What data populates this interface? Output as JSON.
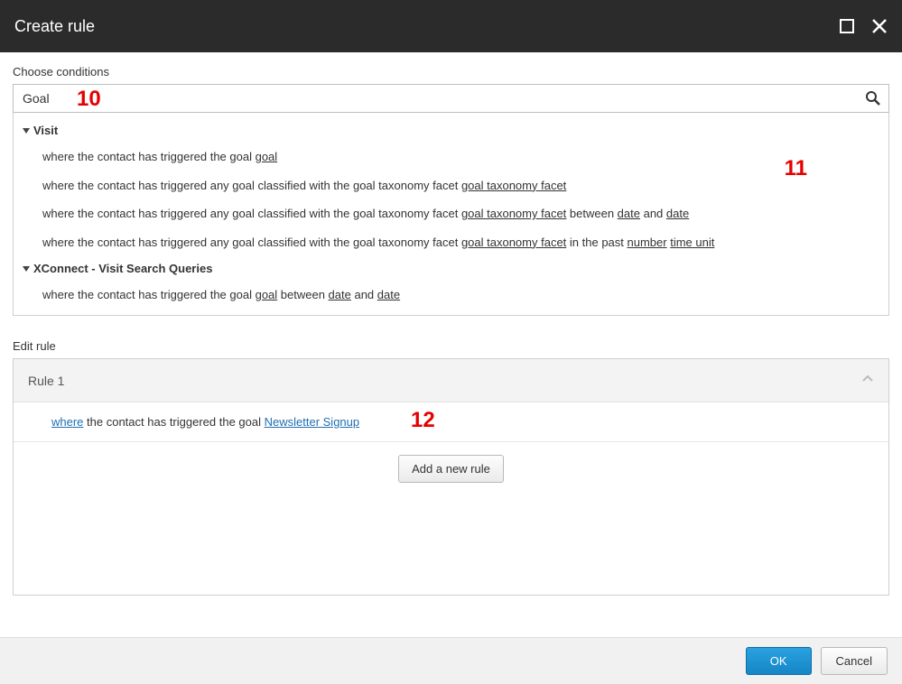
{
  "window": {
    "title": "Create rule"
  },
  "conditions": {
    "label": "Choose conditions",
    "search_value": "Goal",
    "groups": [
      {
        "name": "Visit",
        "items": [
          {
            "prefix": "where the contact has triggered the goal ",
            "parts": [
              {
                "t": "p",
                "v": "goal"
              }
            ]
          },
          {
            "prefix": "where the contact has triggered any goal classified with the goal taxonomy facet ",
            "parts": [
              {
                "t": "p",
                "v": "goal taxonomy facet"
              }
            ]
          },
          {
            "prefix": "where the contact has triggered any goal classified with the goal taxonomy facet ",
            "parts": [
              {
                "t": "p",
                "v": "goal taxonomy facet"
              },
              {
                "t": "s",
                "v": " between "
              },
              {
                "t": "p",
                "v": "date"
              },
              {
                "t": "s",
                "v": " and "
              },
              {
                "t": "p",
                "v": "date"
              }
            ]
          },
          {
            "prefix": "where the contact has triggered any goal classified with the goal taxonomy facet ",
            "parts": [
              {
                "t": "p",
                "v": "goal taxonomy facet"
              },
              {
                "t": "s",
                "v": " in the past "
              },
              {
                "t": "p",
                "v": "number"
              },
              {
                "t": "s",
                "v": " "
              },
              {
                "t": "p",
                "v": "time unit"
              }
            ]
          }
        ]
      },
      {
        "name": "XConnect - Visit Search Queries",
        "items": [
          {
            "prefix": "where the contact has triggered the goal ",
            "parts": [
              {
                "t": "p",
                "v": "goal"
              },
              {
                "t": "s",
                "v": " between "
              },
              {
                "t": "p",
                "v": "date"
              },
              {
                "t": "s",
                "v": " and "
              },
              {
                "t": "p",
                "v": "date"
              }
            ]
          }
        ]
      }
    ]
  },
  "edit": {
    "label": "Edit rule",
    "rule_name": "Rule 1",
    "expression": {
      "where": "where",
      "mid": " the contact has triggered the goal ",
      "value": "Newsletter Signup"
    },
    "add_button": "Add a new rule"
  },
  "footer": {
    "ok": "OK",
    "cancel": "Cancel"
  },
  "annotations": {
    "a10": "10",
    "a11": "11",
    "a12": "12"
  }
}
